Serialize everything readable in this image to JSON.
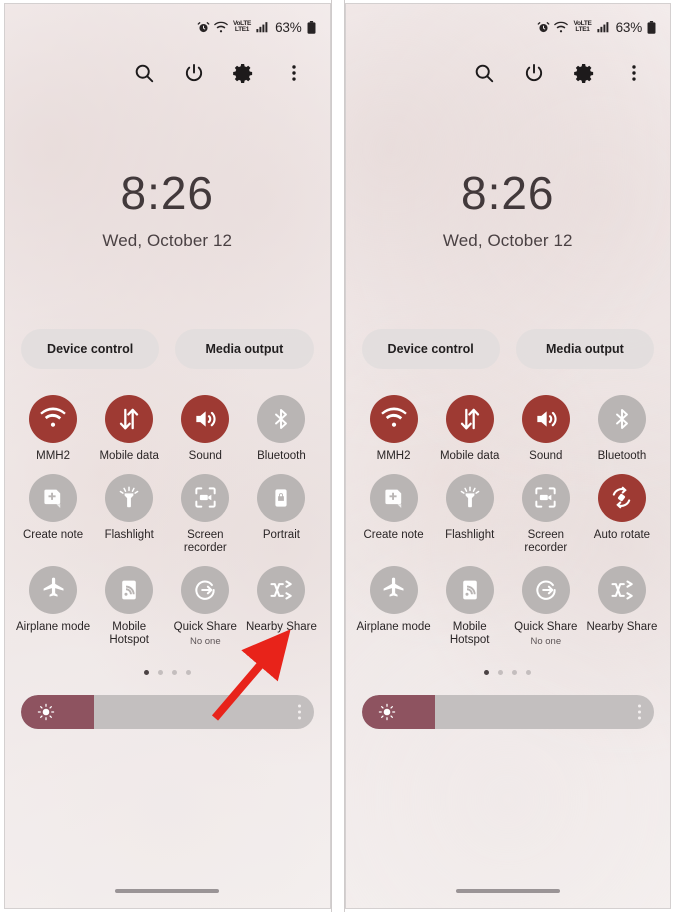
{
  "statusbar": {
    "icons": [
      "alarm-icon",
      "wifi-icon",
      "volte-icon",
      "signal-icon",
      "battery-icon"
    ],
    "volte_top": "VoLTE",
    "volte_bottom": "LTE1",
    "battery_percent": "63%"
  },
  "header": {
    "icons": [
      "search-icon",
      "power-icon",
      "settings-icon",
      "more-options-icon"
    ]
  },
  "clock": {
    "time": "8:26",
    "date": "Wed, October 12"
  },
  "pills": {
    "device_control": "Device control",
    "media_output": "Media output"
  },
  "colors": {
    "tile_active": "#9e3a33",
    "tile_inactive": "#b9b5b4",
    "slider_fill": "#8e5360",
    "arrow": "#e8231a",
    "background": "#f3ecec"
  },
  "left_panel": {
    "tiles": [
      [
        {
          "label": "MMH2",
          "icon": "wifi-icon",
          "state": "on",
          "sub": ""
        },
        {
          "label": "Mobile data",
          "icon": "mobile-data-icon",
          "state": "on",
          "sub": ""
        },
        {
          "label": "Sound",
          "icon": "sound-icon",
          "state": "on",
          "sub": ""
        },
        {
          "label": "Bluetooth",
          "icon": "bluetooth-icon",
          "state": "off",
          "sub": ""
        }
      ],
      [
        {
          "label": "Create note",
          "icon": "create-note-icon",
          "state": "off",
          "sub": ""
        },
        {
          "label": "Flashlight",
          "icon": "flashlight-icon",
          "state": "off",
          "sub": ""
        },
        {
          "label": "Screen recorder",
          "icon": "screen-recorder-icon",
          "state": "off",
          "sub": ""
        },
        {
          "label": "Portrait",
          "icon": "lock-rotation-icon",
          "state": "off",
          "sub": ""
        }
      ],
      [
        {
          "label": "Airplane mode",
          "icon": "airplane-icon",
          "state": "off",
          "sub": ""
        },
        {
          "label": "Mobile Hotspot",
          "icon": "hotspot-icon",
          "state": "off",
          "sub": ""
        },
        {
          "label": "Quick Share",
          "icon": "quick-share-icon",
          "state": "off",
          "sub": "No one"
        },
        {
          "label": "Nearby Share",
          "icon": "nearby-share-icon",
          "state": "off",
          "sub": ""
        }
      ]
    ],
    "page_dots": 4,
    "active_dot": 0,
    "brightness_percent": 25
  },
  "right_panel": {
    "tiles": [
      [
        {
          "label": "MMH2",
          "icon": "wifi-icon",
          "state": "on",
          "sub": ""
        },
        {
          "label": "Mobile data",
          "icon": "mobile-data-icon",
          "state": "on",
          "sub": ""
        },
        {
          "label": "Sound",
          "icon": "sound-icon",
          "state": "on",
          "sub": ""
        },
        {
          "label": "Bluetooth",
          "icon": "bluetooth-icon",
          "state": "off",
          "sub": ""
        }
      ],
      [
        {
          "label": "Create note",
          "icon": "create-note-icon",
          "state": "off",
          "sub": ""
        },
        {
          "label": "Flashlight",
          "icon": "flashlight-icon",
          "state": "off",
          "sub": ""
        },
        {
          "label": "Screen recorder",
          "icon": "screen-recorder-icon",
          "state": "off",
          "sub": ""
        },
        {
          "label": "Auto rotate",
          "icon": "auto-rotate-icon",
          "state": "on",
          "sub": ""
        }
      ],
      [
        {
          "label": "Airplane mode",
          "icon": "airplane-icon",
          "state": "off",
          "sub": ""
        },
        {
          "label": "Mobile Hotspot",
          "icon": "hotspot-icon",
          "state": "off",
          "sub": ""
        },
        {
          "label": "Quick Share",
          "icon": "quick-share-icon",
          "state": "off",
          "sub": "No one"
        },
        {
          "label": "Nearby Share",
          "icon": "nearby-share-icon",
          "state": "off",
          "sub": ""
        }
      ]
    ],
    "page_dots": 4,
    "active_dot": 0,
    "brightness_percent": 25
  },
  "annotation": {
    "arrow_target": "Portrait"
  }
}
